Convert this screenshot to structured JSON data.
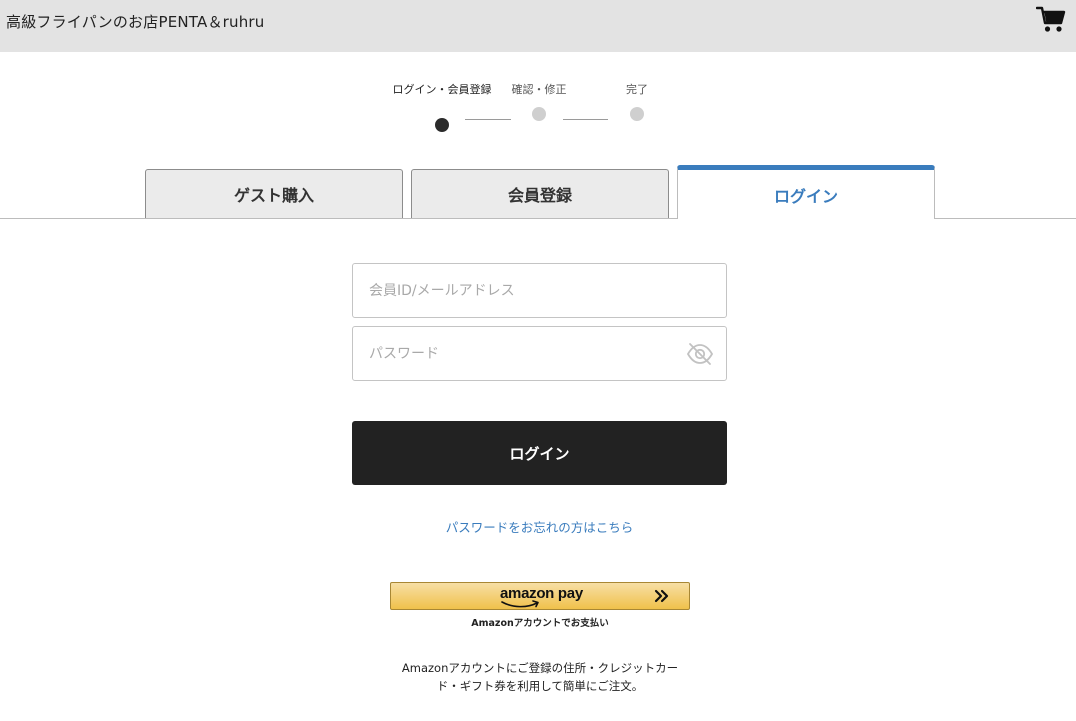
{
  "header": {
    "shop_title": "高級フライパンのお店PENTA＆ruhru",
    "cart_icon": "cart-icon"
  },
  "steps": [
    {
      "label": "ログイン・会員登録",
      "active": true
    },
    {
      "label": "確認・修正",
      "active": false
    },
    {
      "label": "完了",
      "active": false
    }
  ],
  "tabs": [
    {
      "label": "ゲスト購入",
      "active": false
    },
    {
      "label": "会員登録",
      "active": false
    },
    {
      "label": "ログイン",
      "active": true
    }
  ],
  "form": {
    "id_field": {
      "value": "",
      "placeholder": "会員ID/メールアドレス"
    },
    "password_field": {
      "value": "",
      "placeholder": "パスワード",
      "icon": "eye-slash-icon"
    },
    "login_button": "ログイン",
    "forgot_link": "パスワードをお忘れの方はこちら"
  },
  "amazon_pay": {
    "logo_text": "amazon pay",
    "caption": "Amazonアカウントでお支払い",
    "note_line1": "Amazonアカウントにご登録の住所・クレジットカー",
    "note_line2": "ド・ギフト券を利用して簡単にご注文。"
  },
  "colors": {
    "accent": "#3a7cbd",
    "header_bg": "#e3e3e3",
    "button_bg": "#222222",
    "amazon_yellow": "#f0c14b"
  }
}
